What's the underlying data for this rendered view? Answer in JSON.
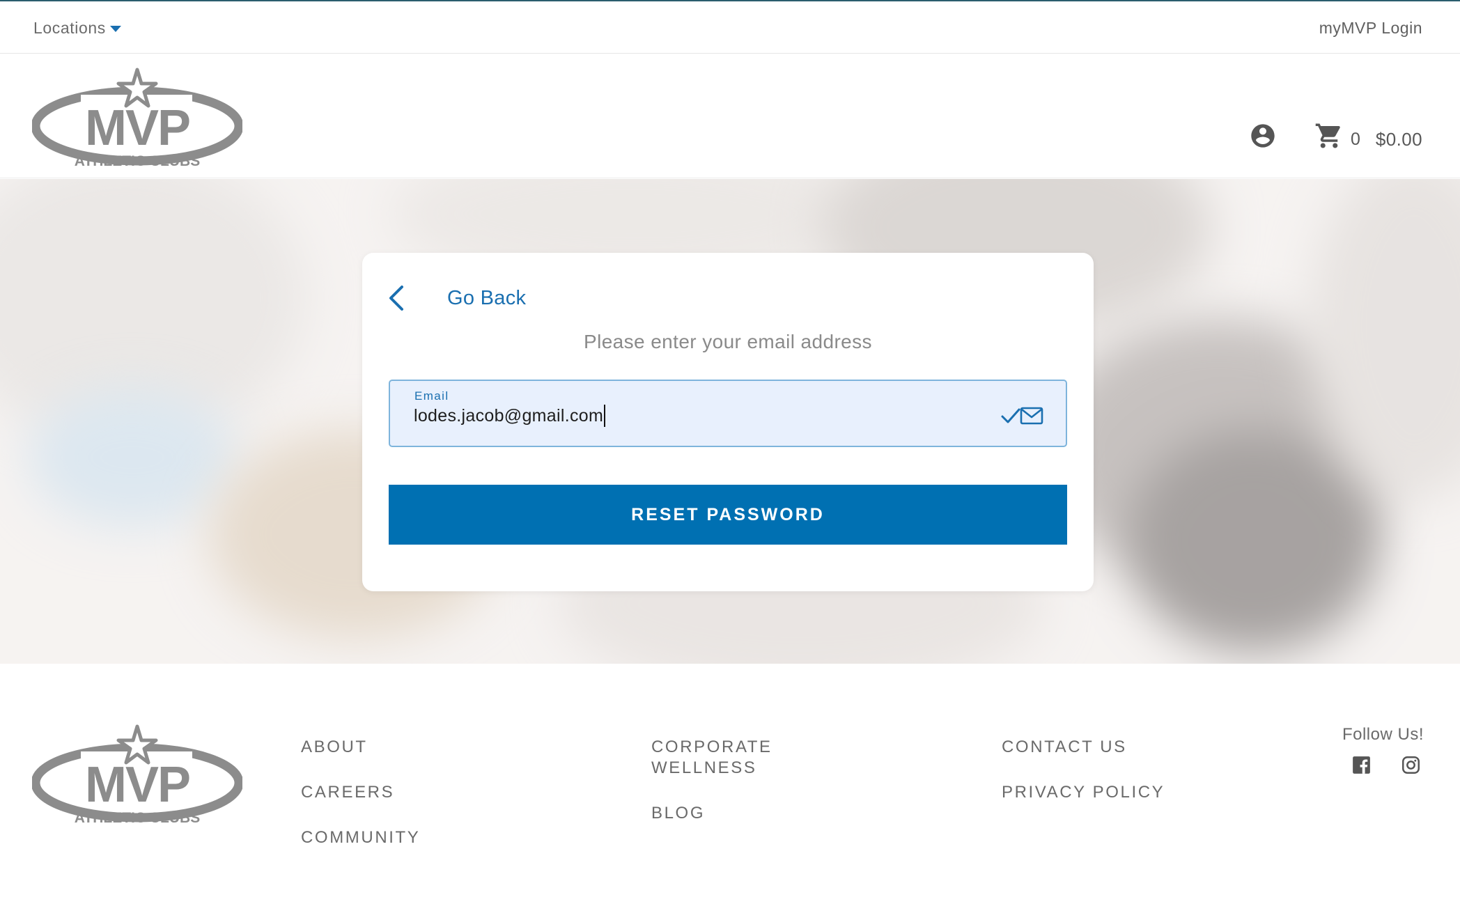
{
  "utility": {
    "locations_label": "Locations",
    "login_label": "myMVP Login"
  },
  "brand": {
    "logo_main": "MVP",
    "logo_sub": "ATHLETIC CLUBS"
  },
  "cart": {
    "count": "0",
    "total": "$0.00"
  },
  "reset_form": {
    "back_label": "Go Back",
    "instruction": "Please enter your email address",
    "email_label": "Email",
    "email_value": "lodes.jacob@gmail.com",
    "submit_label": "RESET PASSWORD"
  },
  "footer": {
    "col1": [
      "ABOUT",
      "CAREERS",
      "COMMUNITY"
    ],
    "col2": [
      "CORPORATE WELLNESS",
      "BLOG"
    ],
    "col3": [
      "CONTACT US",
      "PRIVACY POLICY"
    ],
    "follow_label": "Follow Us!"
  },
  "icons": {
    "account": "account-circle-icon",
    "cart": "shopping-cart-icon",
    "back": "chevron-left-icon",
    "check": "check-icon",
    "mail": "mail-icon",
    "facebook": "facebook-icon",
    "instagram": "instagram-icon"
  },
  "colors": {
    "accent": "#0070b2",
    "link": "#1a6fb0",
    "field_bg": "#e8f0fd",
    "logo_gray": "#8c8c8c"
  }
}
